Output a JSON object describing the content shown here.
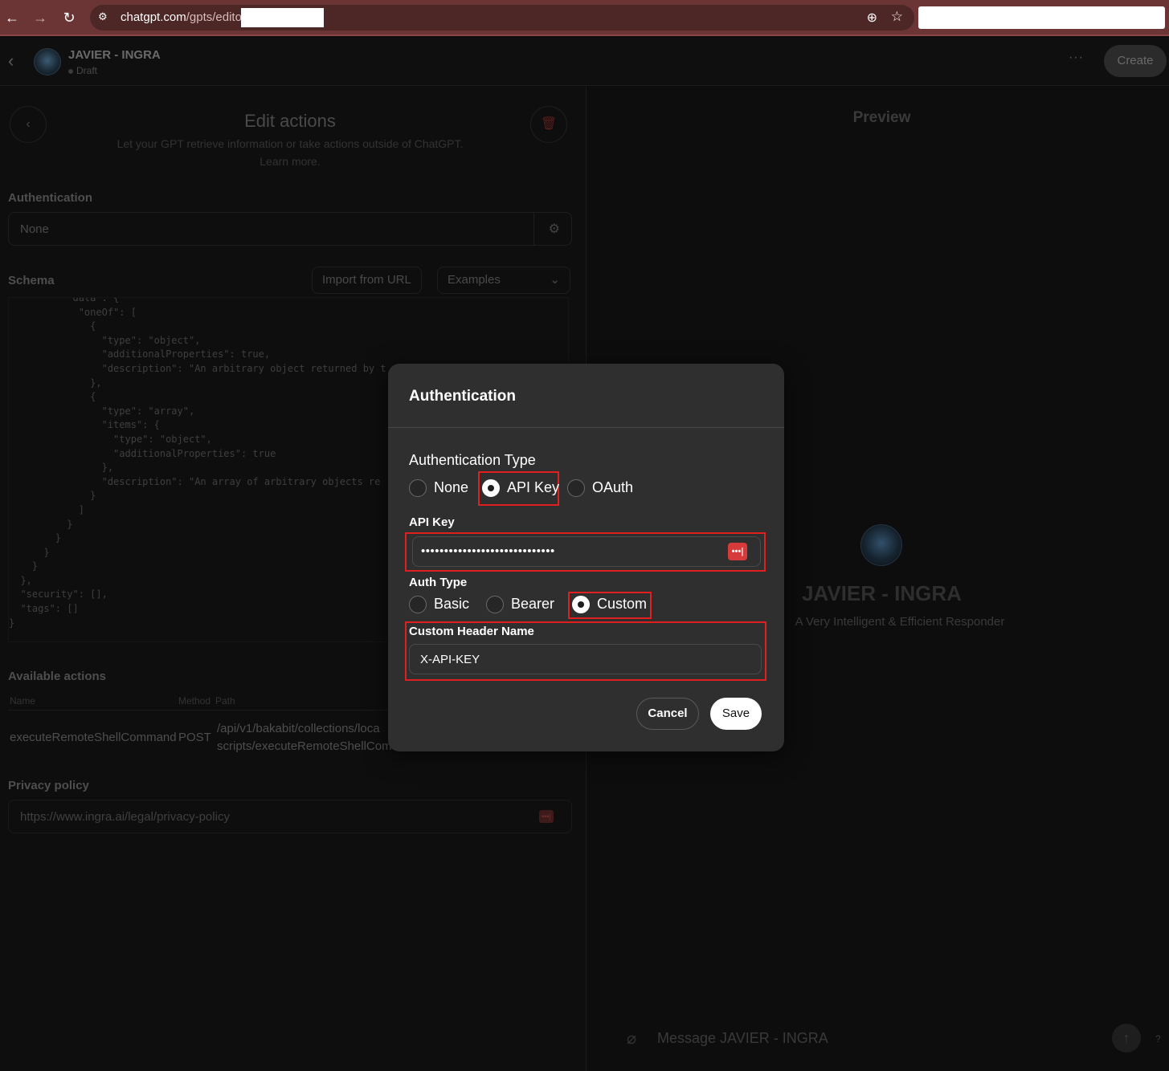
{
  "browser": {
    "url_host": "chatgpt.com",
    "url_path": "/gpts/editor"
  },
  "header": {
    "gpt_name": "JAVIER - INGRA",
    "status": "Draft",
    "more": "···",
    "create_label": "Create"
  },
  "editor": {
    "title": "Edit actions",
    "subtitle": "Let your GPT retrieve information or take actions outside of ChatGPT.",
    "learn_more": "Learn more.",
    "authentication_label": "Authentication",
    "authentication_value": "None",
    "schema_label": "Schema",
    "import_label": "Import from URL",
    "examples_label": "Examples",
    "schema_text": "          \"data\": {\n            \"oneOf\": [\n              {\n                \"type\": \"object\",\n                \"additionalProperties\": true,\n                \"description\": \"An arbitrary object returned by t\n              },\n              {\n                \"type\": \"array\",\n                \"items\": {\n                  \"type\": \"object\",\n                  \"additionalProperties\": true\n                },\n                \"description\": \"An array of arbitrary objects re\n              }\n            ]\n          }\n        }\n      }\n    }\n  },\n  \"security\": [],\n  \"tags\": []\n}",
    "available_actions_label": "Available actions",
    "table_headers": [
      "Name",
      "Method",
      "Path"
    ],
    "actions": [
      {
        "name": "executeRemoteShellCommand",
        "method": "POST",
        "path_line1": "/api/v1/bakabit/collections/loca",
        "path_line2": "scripts/executeRemoteShellCom"
      }
    ],
    "privacy_label": "Privacy policy",
    "privacy_value": "https://www.ingra.ai/legal/privacy-policy"
  },
  "preview": {
    "title": "Preview",
    "gpt_name": "JAVIER - INGRA",
    "description": "A Very Intelligent & Efficient Responder",
    "message_placeholder": "Message JAVIER - INGRA",
    "help": "?"
  },
  "modal": {
    "title": "Authentication",
    "auth_type_label": "Authentication Type",
    "auth_types": [
      "None",
      "API Key",
      "OAuth"
    ],
    "auth_type_selected": "API Key",
    "api_key_label": "API Key",
    "api_key_value": "•••••••••••••••••••••••••••••",
    "pw_manager": "•••|",
    "auth_subtype_label": "Auth Type",
    "auth_subtypes": [
      "Basic",
      "Bearer",
      "Custom"
    ],
    "auth_subtype_selected": "Custom",
    "custom_header_label": "Custom Header Name",
    "custom_header_value": "X-API-KEY",
    "cancel_label": "Cancel",
    "save_label": "Save"
  },
  "colors": {
    "highlight": "#e02020",
    "browser_bar": "#6b3535",
    "modal_bg": "#2f2f2f"
  }
}
